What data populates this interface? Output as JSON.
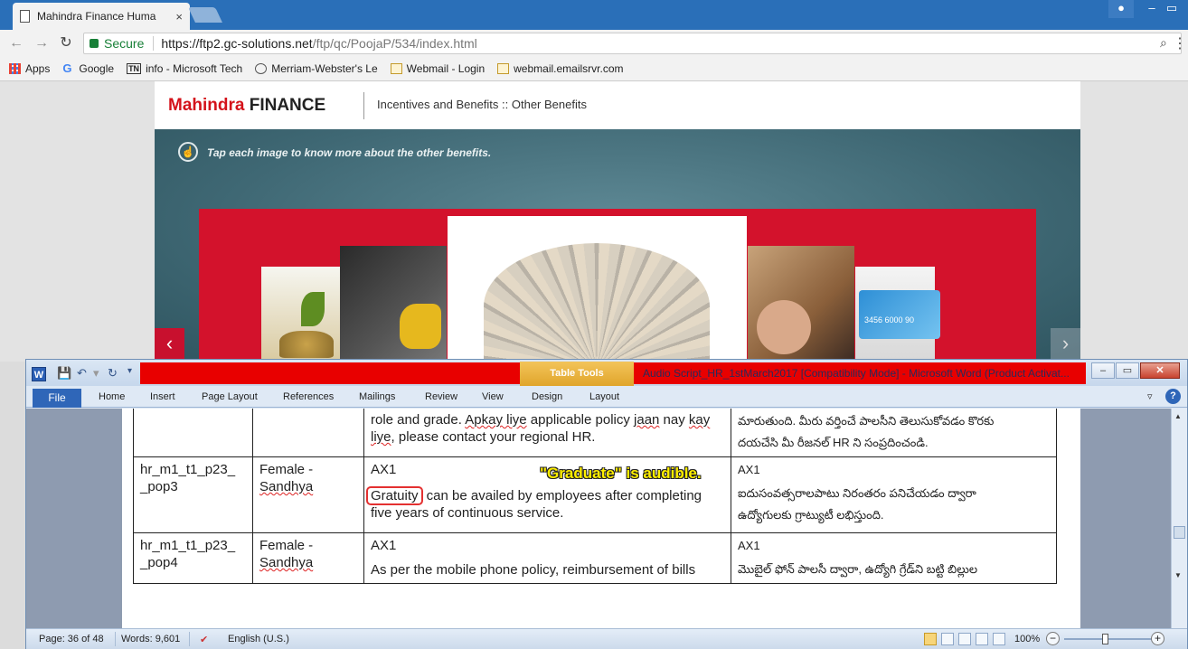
{
  "browser": {
    "tab_title": "Mahindra Finance Huma",
    "tab_close": "×",
    "url_secure": "Secure",
    "url_host": "https://ftp2.gc-solutions.net",
    "url_path": "/ftp/qc/PoojaP/534/index.html",
    "bookmarks": [
      {
        "label": "Apps",
        "icon": "apps-grid-icon",
        "color": "#e94235"
      },
      {
        "label": "Google",
        "icon": "google-g-icon",
        "color": "#4285f4"
      },
      {
        "label": "info - Microsoft Tech",
        "icon": "tn-icon",
        "color": "#333333"
      },
      {
        "label": "Merriam-Webster's Le",
        "icon": "globe-icon",
        "color": "#555555"
      },
      {
        "label": "Webmail - Login",
        "icon": "mail-icon",
        "color": "#c49a2c"
      },
      {
        "label": "webmail.emailsrvr.com",
        "icon": "mail-icon",
        "color": "#c49a2c"
      }
    ]
  },
  "website": {
    "logo_red": "Mahindra",
    "logo_dark": "FINANCE",
    "header_title": "Incentives and Benefits :: Other Benefits",
    "instruction": "Tap each image to know more about the other benefits.",
    "brand_color": "#d3122c",
    "prev_arrow": "‹",
    "next_arrow": "›",
    "card_number": "3456 6000 90"
  },
  "word": {
    "app_letter": "W",
    "table_tools": "Table Tools",
    "doc_title": "Audio Script_HR_1stMarch2017 [Compatibility Mode]  -  Microsoft Word (Product Activat...",
    "ribbon_tabs": [
      "File",
      "Home",
      "Insert",
      "Page Layout",
      "References",
      "Mailings",
      "Review",
      "View",
      "Design",
      "Layout"
    ],
    "help": "?",
    "rows": [
      {
        "id": "",
        "speaker": "",
        "en_tag": "",
        "en_pre": "role and grade. ",
        "en_sq1": "Apkay liye",
        "en_mid": " applicable policy ",
        "en_sq2": "jaan",
        "en_mid2": " nay ",
        "en_sq3": "kay liye",
        "en_post": ", please contact your regional HR.",
        "te_tag": "",
        "te_1": "మారుతుంది. మీరు వర్తించే పాలసీని తెలుసుకోవడం కొరకు",
        "te_2": "దయచేసి మీ రీజనల్ HR ని సంప్రదించండి."
      },
      {
        "id": "hr_m1_t1_p23_\n_pop3",
        "speaker_1": "Female -",
        "speaker_2": "Sandhya",
        "en_tag": "AX1",
        "en_boxed": "Gratuity",
        "en_text": " can be availed by employees after completing five years of continuous service.",
        "te_tag": "AX1",
        "te_1": "ఐదుసంవత్సరాలపాటు నిరంతరం పనిచేయడం ద్వారా",
        "te_2": "ఉద్యోగులకు గ్రాట్యుటీ లభిస్తుంది."
      },
      {
        "id": "hr_m1_t1_p23_\n_pop4",
        "speaker_1": "Female -",
        "speaker_2": "Sandhya",
        "en_tag": "AX1",
        "en_text": "As per the mobile phone policy, reimbursement of bills",
        "te_tag": "AX1",
        "te_1": "మొబైల్ ఫోన్ పాలసీ ద్వారా, ఉద్యోగి గ్రేడ్‌ని బట్టి బిల్లుల"
      }
    ],
    "annotation": "\"Graduate\" is audible.",
    "status": {
      "page": "Page: 36 of 48",
      "words": "Words: 9,601",
      "language": "English (U.S.)",
      "zoom": "100%",
      "zoom_minus": "−",
      "zoom_plus": "+"
    }
  }
}
